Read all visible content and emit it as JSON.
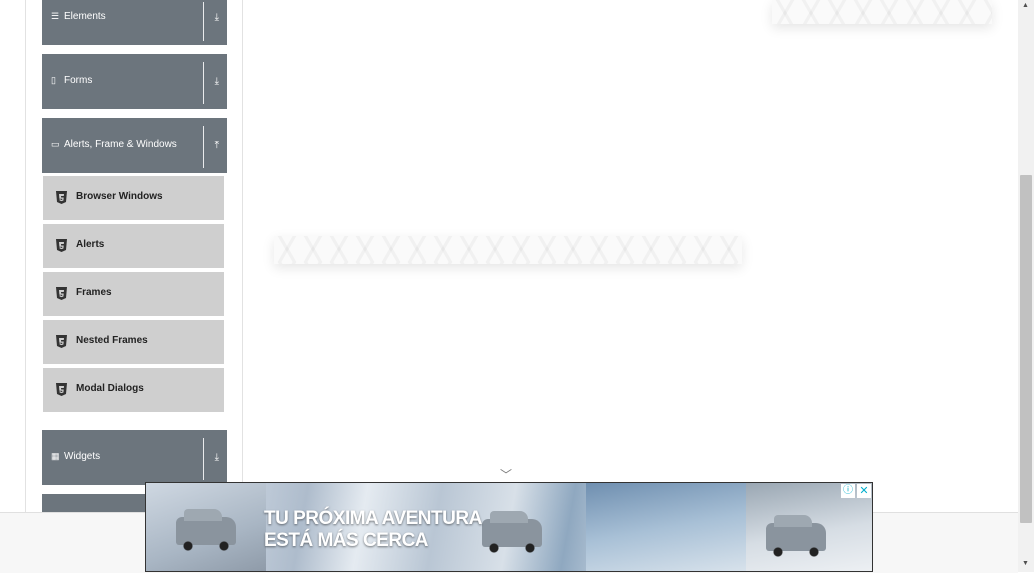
{
  "sidebar": {
    "groups": [
      {
        "label": "Elements",
        "icon": "menu-icon",
        "arrow": "download-arrow-icon"
      },
      {
        "label": "Forms",
        "icon": "form-icon",
        "arrow": "download-arrow-icon"
      },
      {
        "label": "Alerts, Frame & Windows",
        "icon": "window-icon",
        "arrow": "upload-arrow-icon"
      },
      {
        "label": "Widgets",
        "icon": "grid-icon",
        "arrow": "download-arrow-icon"
      }
    ],
    "submenu": [
      {
        "label": "Browser Windows",
        "icon": "html5-icon"
      },
      {
        "label": "Alerts",
        "icon": "html5-icon"
      },
      {
        "label": "Frames",
        "icon": "html5-icon"
      },
      {
        "label": "Nested Frames",
        "icon": "html5-icon"
      },
      {
        "label": "Modal Dialogs",
        "icon": "html5-icon"
      }
    ]
  },
  "ad": {
    "headline_line1": "TU PRÓXIMA AVENTURA",
    "headline_line2": "ESTÁ MÁS CERCA",
    "adchoices_icon": "info-icon",
    "close_icon": "close-icon"
  },
  "colors": {
    "group_header_bg": "#6c757d",
    "submenu_bg": "#cfcfcf",
    "adchoices_accent": "#00aecd"
  }
}
